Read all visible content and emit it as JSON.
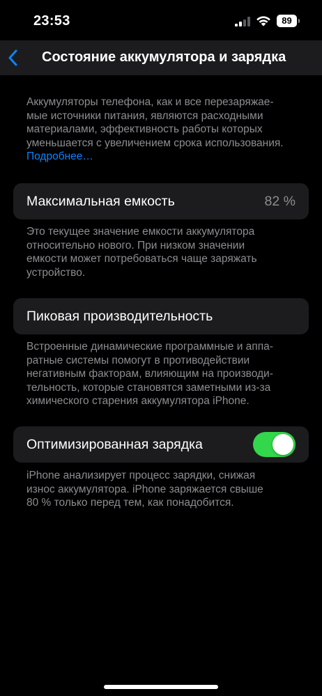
{
  "status_bar": {
    "time": "23:53",
    "battery_level": "89",
    "icons": [
      "cellular-signal-icon",
      "wifi-icon",
      "battery-icon"
    ]
  },
  "nav": {
    "back_icon": "chevron-left-icon",
    "title": "Состояние аккумулятора и зарядка"
  },
  "intro": {
    "lines": [
      "Аккумуляторы телефона, как и все перезаряжае-",
      "мые источники питания, являются расходными",
      "материалами, эффективность работы которых",
      "уменьшается с увеличением срока использования."
    ],
    "link": "Подробнее…"
  },
  "max_capacity": {
    "label": "Максимальная емкость",
    "value": "82 %",
    "description_lines": [
      "Это текущее значение емкости аккумулятора",
      "относительно нового. При низком значении",
      "емкости может потребоваться чаще заряжать",
      "устройство."
    ]
  },
  "peak_performance": {
    "label": "Пиковая производительность",
    "description_lines": [
      "Встроенные динамические программные и аппа-",
      "ратные системы помогут в противодействии",
      "негативным факторам, влияющим на производи-",
      "тельность, которые становятся заметными из-за",
      "химического старения аккумулятора iPhone."
    ]
  },
  "optimized_charging": {
    "label": "Оптимизированная зарядка",
    "enabled": true,
    "description_lines": [
      "iPhone анализирует процесс зарядки, снижая",
      "износ аккумулятора. iPhone заряжается свыше",
      "80 % только перед тем, как понадобится."
    ]
  },
  "colors": {
    "background": "#000000",
    "card": "#1c1c1e",
    "secondary_text": "#8d8d92",
    "link": "#0a84ff",
    "toggle_on": "#32d74b"
  }
}
